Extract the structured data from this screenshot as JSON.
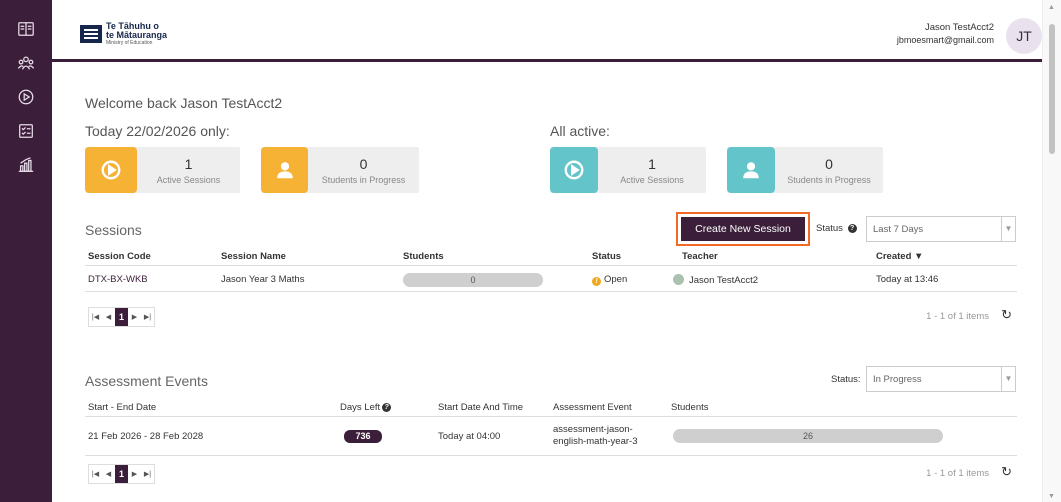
{
  "sidebar": {
    "items": [
      {
        "icon": "book-icon"
      },
      {
        "icon": "users-icon"
      },
      {
        "icon": "play-circle-icon"
      },
      {
        "icon": "checklist-icon"
      },
      {
        "icon": "reports-chart-icon"
      }
    ]
  },
  "header": {
    "logo_line1": "Te Tāhuhu o",
    "logo_line2": "te Mātauranga",
    "logo_line3": "Ministry of Education",
    "user_name": "Jason TestAcct2",
    "user_email": "jbmoesmart@gmail.com",
    "avatar_initials": "JT"
  },
  "welcome": "Welcome back Jason TestAcct2",
  "today": {
    "label": "Today 22/02/2026 only:",
    "cards": [
      {
        "count": "1",
        "label": "Active Sessions",
        "icon": "play-circle-icon",
        "color": "#f5b234"
      },
      {
        "count": "0",
        "label": "Students in Progress",
        "icon": "person-icon",
        "color": "#f5b234"
      }
    ]
  },
  "all_active": {
    "label": "All active:",
    "cards": [
      {
        "count": "1",
        "label": "Active Sessions",
        "icon": "play-circle-icon",
        "color": "#63c5c9"
      },
      {
        "count": "0",
        "label": "Students in Progress",
        "icon": "person-icon",
        "color": "#63c5c9"
      }
    ]
  },
  "sessions": {
    "title": "Sessions",
    "create_button": "Create New Session",
    "status_label": "Status",
    "status_value": "Last 7 Days",
    "columns": [
      "Session Code",
      "Session Name",
      "Students",
      "Status",
      "Teacher",
      "Created ▼"
    ],
    "rows": [
      {
        "code": "DTX-BX-WKB",
        "name": "Jason Year 3 Maths",
        "students": "0",
        "status": "Open",
        "teacher": "Jason TestAcct2",
        "created": "Today at 13:46"
      }
    ],
    "page": "1",
    "items_label": "1 - 1 of 1 items"
  },
  "assessment": {
    "title": "Assessment Events",
    "status_label": "Status:",
    "status_value": "In Progress",
    "columns": [
      "Start - End Date",
      "Days Left",
      "Start Date And Time",
      "Assessment Event",
      "Students"
    ],
    "rows": [
      {
        "dates": "21 Feb 2026 - 28 Feb 2028",
        "days_left": "736",
        "start": "Today at 04:00",
        "event_line1": "assessment-jason-",
        "event_line2": "english-math-year-3",
        "students": "26"
      }
    ],
    "page": "1",
    "items_label": "1 - 1 of 1 items"
  },
  "colors": {
    "brand": "#3b1f3a",
    "accent_orange": "#f5b234",
    "accent_teal": "#63c5c9",
    "highlight": "#f26a26"
  }
}
